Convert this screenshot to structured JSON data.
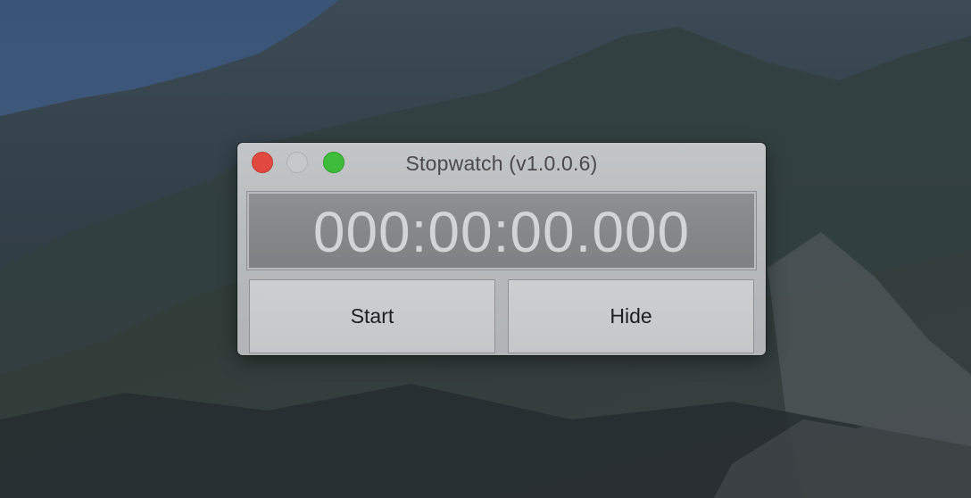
{
  "window": {
    "title": "Stopwatch (v1.0.0.6)"
  },
  "stopwatch": {
    "display": "000:00:00.000"
  },
  "buttons": {
    "start_label": "Start",
    "hide_label": "Hide"
  },
  "colors": {
    "close": "#e0493f",
    "minimize": "#c6c7c9",
    "zoom": "#3ebd3a"
  },
  "icons": {
    "close": "close-icon",
    "minimize": "minimize-icon",
    "zoom": "zoom-icon"
  }
}
